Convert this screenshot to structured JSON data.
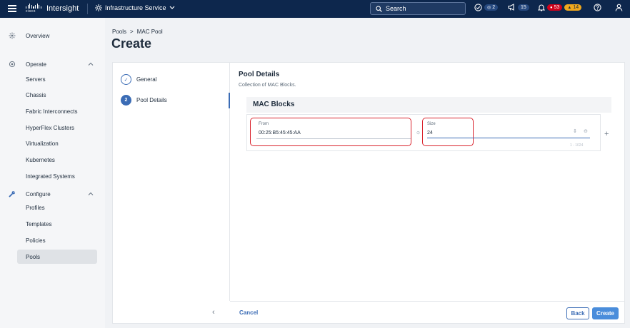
{
  "topbar": {
    "brand": "Intersight",
    "cisco_word": "cisco",
    "service": "Infrastructure Service",
    "search_label": "Search",
    "requests_count": "2",
    "announcements_count": "15",
    "alarms_critical": "53",
    "alarms_warning": "14"
  },
  "sidebar": {
    "overview": "Overview",
    "operate": "Operate",
    "operate_items": [
      "Servers",
      "Chassis",
      "Fabric Interconnects",
      "HyperFlex Clusters",
      "Virtualization",
      "Kubernetes",
      "Integrated Systems"
    ],
    "configure": "Configure",
    "configure_items": [
      "Profiles",
      "Templates",
      "Policies",
      "Pools"
    ],
    "active_item": "Pools"
  },
  "header": {
    "breadcrumb": [
      "Pools",
      ">",
      "MAC Pool"
    ],
    "title": "Create"
  },
  "wizard": {
    "steps": [
      {
        "label": "General",
        "state": "done",
        "marker": "✓"
      },
      {
        "label": "Pool Details",
        "state": "current",
        "marker": "2"
      }
    ]
  },
  "content": {
    "section_title": "Pool Details",
    "section_desc": "Collection of MAC Blocks.",
    "blocks_title": "MAC Blocks",
    "from_label": "From",
    "from_value": "00:25:B5:45:45:AA",
    "size_label": "Size",
    "size_value": "24",
    "size_range": "1 - 1024"
  },
  "footer": {
    "cancel": "Cancel",
    "back": "Back",
    "create": "Create"
  },
  "colors": {
    "topbar_bg": "#0d274d",
    "accent": "#3b6cb5",
    "highlight_box": "#d9232d"
  }
}
